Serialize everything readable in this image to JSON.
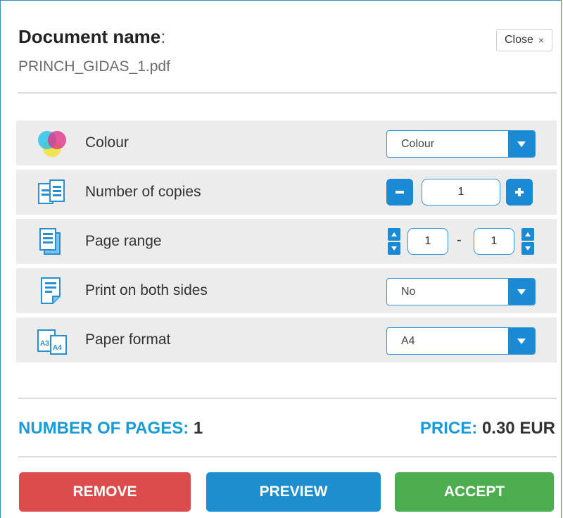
{
  "header": {
    "doc_label": "Document name",
    "doc_colon": ":",
    "file_name": "PRINCH_GIDAS_1.pdf",
    "close_label": "Close",
    "close_glyph": "×"
  },
  "options": {
    "colour": {
      "label": "Colour",
      "value": "Colour",
      "icon": "colour-circles-icon"
    },
    "copies": {
      "label": "Number of copies",
      "value": "1",
      "icon": "copies-icon"
    },
    "page_range": {
      "label": "Page range",
      "from": "1",
      "separator": "-",
      "to": "1",
      "icon": "page-range-icon"
    },
    "duplex": {
      "label": "Print on both sides",
      "value": "No",
      "icon": "duplex-icon"
    },
    "paper": {
      "label": "Paper format",
      "value": "A4",
      "icon": "paper-format-icon",
      "icon_text_a": "A3",
      "icon_text_b": "A4"
    }
  },
  "summary": {
    "pages_label": "NUMBER OF PAGES:",
    "pages_value": "1",
    "price_label": "PRICE:",
    "price_value": "0.30 EUR"
  },
  "actions": {
    "remove": "REMOVE",
    "preview": "PREVIEW",
    "accept": "ACCEPT"
  },
  "colors": {
    "accent": "#1a8ad4",
    "summary_key": "#1b9ad8",
    "remove": "#dc4c4c",
    "preview": "#1d8fcf",
    "accept": "#4cae4f"
  }
}
